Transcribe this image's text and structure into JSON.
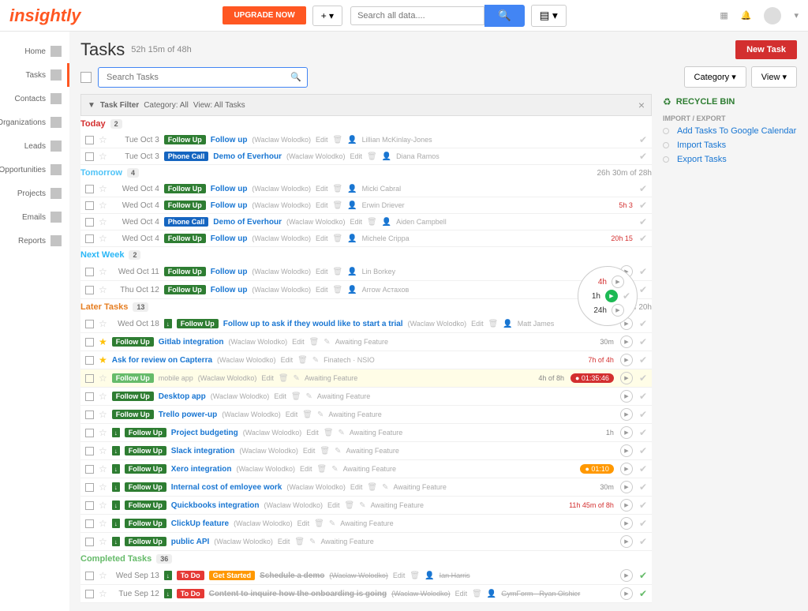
{
  "top": {
    "logo": "insightly",
    "upgrade": "UPGRADE NOW",
    "search_placeholder": "Search all data....",
    "plus": "+",
    "filter_toggle": "▤ ▾"
  },
  "sidenav": [
    {
      "label": "Home"
    },
    {
      "label": "Tasks"
    },
    {
      "label": "Contacts"
    },
    {
      "label": "Organizations"
    },
    {
      "label": "Leads"
    },
    {
      "label": "Opportunities"
    },
    {
      "label": "Projects"
    },
    {
      "label": "Emails"
    },
    {
      "label": "Reports"
    }
  ],
  "page": {
    "title": "Tasks",
    "subtitle": "52h 15m of 48h",
    "new_task": "New Task",
    "search_tasks_placeholder": "Search Tasks",
    "category_btn": "Category ▾",
    "view_btn": "View ▾"
  },
  "filter_bar": {
    "filter_label": "Task Filter",
    "category": "Category: All",
    "view": "View: All Tasks"
  },
  "right_panel": {
    "recycle": "RECYCLE BIN",
    "import_export": "IMPORT / EXPORT",
    "links": [
      "Add Tasks To Google Calendar",
      "Import Tasks",
      "Export Tasks"
    ]
  },
  "sections": {
    "today": {
      "label": "Today",
      "count": "2"
    },
    "tomorrow": {
      "label": "Tomorrow",
      "count": "4",
      "right": "26h 30m of 28h"
    },
    "next_week": {
      "label": "Next Week",
      "count": "2"
    },
    "later": {
      "label": "Later Tasks",
      "count": "13",
      "right": "25h 45m of 20h"
    },
    "completed": {
      "label": "Completed Tasks",
      "count": "36"
    }
  },
  "tags": {
    "followup": "Follow Up",
    "phonecall": "Phone Call",
    "todo": "To Do",
    "getstarted": "Get Started"
  },
  "common": {
    "edit": "Edit",
    "awaiting": "Awaiting Feature"
  },
  "dates": {
    "tue3": "Tue Oct 3",
    "wed4": "Wed Oct 4",
    "wed11": "Wed Oct 11",
    "thu12": "Thu Oct 12",
    "wed18": "Wed Oct 18",
    "wed13": "Wed Sep 13",
    "tue12": "Tue Sep 12"
  },
  "assignee_meta": "(Waclaw Wolodko)",
  "today_rows": [
    {
      "title": "Follow up",
      "assignee": "Lillian McKinlay-Jones"
    },
    {
      "title": "Demo of Everhour",
      "tag": "phonecall",
      "assignee": "Diana Ramos"
    }
  ],
  "tomorrow_rows": [
    {
      "title": "Follow up",
      "assignee": "Micki Cabral"
    },
    {
      "title": "Follow up",
      "assignee": "Erwin Driever",
      "right": "5h 3"
    },
    {
      "title": "Demo of Everhour",
      "tag": "phonecall",
      "assignee": "Aiden Campbell"
    },
    {
      "title": "Follow up",
      "assignee": "Michele Crippa",
      "right": "20h 15"
    }
  ],
  "nextweek_rows": [
    {
      "date": "wed11",
      "title": "Follow up",
      "assignee": "Lin Borkey"
    },
    {
      "date": "thu12",
      "title": "Follow up",
      "assignee": "Arrow Астахов"
    }
  ],
  "later_rows": [
    {
      "date": "wed18",
      "title": "Follow up to ask if they would like to start a trial",
      "assignee": "Matt James",
      "arrow": true
    },
    {
      "star": true,
      "title": "Gitlab integration",
      "meta2": "Awaiting Feature",
      "right_text": "30m"
    },
    {
      "star": true,
      "title": "Ask for review on Capterra",
      "meta2": "Finatech · NSIO",
      "notag": true,
      "right_red": "7h of 4h"
    },
    {
      "hl": true,
      "fade": true,
      "title": "mobile app",
      "meta2": "Awaiting Feature",
      "right_text2": "4h of 8h",
      "pill": "01:35:46",
      "pill_color": "red"
    },
    {
      "title": "Desktop app",
      "meta2": "Awaiting Feature"
    },
    {
      "title": "Trello power-up",
      "meta2": "Awaiting Feature"
    },
    {
      "arrow": true,
      "title": "Project budgeting",
      "meta2": "Awaiting Feature",
      "right_text": "1h"
    },
    {
      "arrow": true,
      "title": "Slack integration",
      "meta2": "Awaiting Feature"
    },
    {
      "arrow": true,
      "title": "Xero integration",
      "meta2": "Awaiting Feature",
      "pill": "01:10",
      "pill_color": "orange"
    },
    {
      "arrow": true,
      "title": "Internal cost of emloyee work",
      "meta2": "Awaiting Feature",
      "right_text": "30m"
    },
    {
      "arrow": true,
      "title": "Quickbooks integration",
      "meta2": "Awaiting Feature",
      "right_red": "11h 45m of 8h"
    },
    {
      "arrow": true,
      "title": "ClickUp feature",
      "meta2": "Awaiting Feature"
    },
    {
      "arrow": true,
      "title": "public API",
      "meta2": "Awaiting Feature"
    }
  ],
  "completed_rows": [
    {
      "date": "wed13",
      "tag1": "todo",
      "tag2": "getstarted",
      "title": "Schedule a demo",
      "assignee": "Ian Harris"
    },
    {
      "date": "tue12",
      "tag1": "todo",
      "title": "Content to inquire how the onboarding is going",
      "assignee": "GymForm · Ryan Olshier"
    }
  ],
  "timer": {
    "t1": "4h",
    "t2": "1h",
    "t3": "24h"
  }
}
